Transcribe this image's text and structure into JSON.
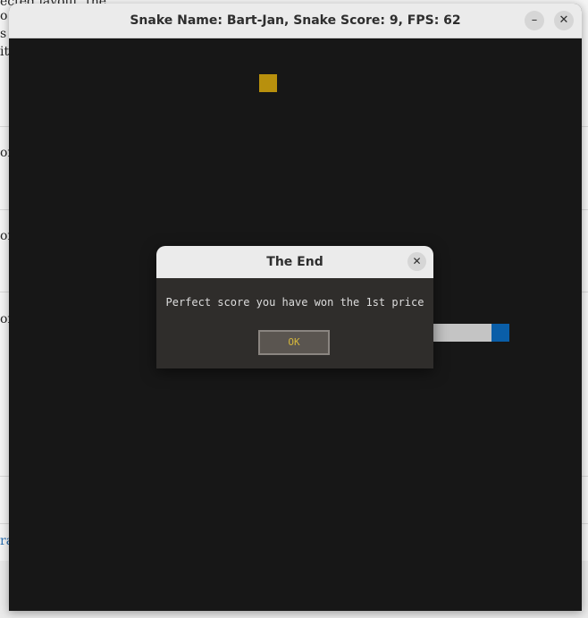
{
  "background": {
    "text_fragments": [
      "ected layout, the",
      "o",
      "s a",
      "it",
      "on",
      "on",
      "on"
    ],
    "link_fragment": "ra"
  },
  "window": {
    "title": "Snake Name: Bart-Jan, Snake Score: 9, FPS: 62",
    "minimize_glyph": "–",
    "close_glyph": "✕"
  },
  "game": {
    "colors": {
      "background": "#171717",
      "food": "#b8900d",
      "snake_body": "#c4c4c4",
      "snake_head": "#0a5ea8"
    }
  },
  "dialog": {
    "title": "The End",
    "close_glyph": "✕",
    "message": "Perfect score you have won the 1st price",
    "ok_label": "OK"
  }
}
